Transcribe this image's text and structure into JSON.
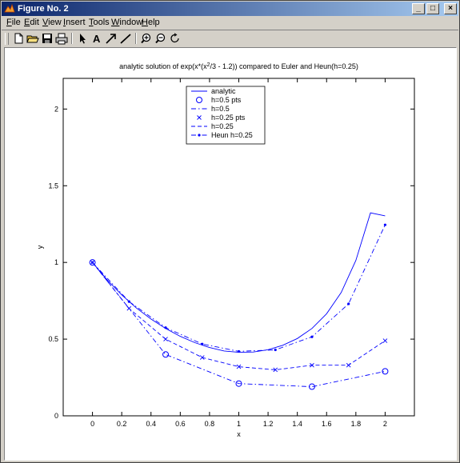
{
  "window": {
    "title": "Figure No. 2",
    "buttons": {
      "minimize": "_",
      "maximize": "□",
      "close": "×"
    }
  },
  "menu": {
    "items": [
      {
        "label": "File",
        "key": "F"
      },
      {
        "label": "Edit",
        "key": "E"
      },
      {
        "label": "View",
        "key": "V"
      },
      {
        "label": "Insert",
        "key": "I"
      },
      {
        "label": "Tools",
        "key": "T"
      },
      {
        "label": "Window",
        "key": "W"
      },
      {
        "label": "Help",
        "key": "H"
      }
    ]
  },
  "toolbar": {
    "icons": [
      "new-file-icon",
      "open-folder-icon",
      "save-icon",
      "print-icon",
      "arrow-select-icon",
      "text-insert-icon",
      "arrow-insert-icon",
      "line-insert-icon",
      "zoom-in-icon",
      "zoom-out-icon",
      "rotate-3d-icon"
    ]
  },
  "chart_data": {
    "type": "line",
    "title": "analytic solution of exp(x*(x²/3 - 1.2)) compared to Euler and Heun(h=0.25)",
    "xlabel": "x",
    "ylabel": "y",
    "xlim": [
      -0.2,
      2.2
    ],
    "ylim": [
      0,
      2.2
    ],
    "xticks": [
      "0",
      "0.2",
      "0.4",
      "0.6",
      "0.8",
      "1",
      "1.2",
      "1.4",
      "1.6",
      "1.8",
      "2"
    ],
    "xtick_values": [
      0,
      0.2,
      0.4,
      0.6,
      0.8,
      1,
      1.2,
      1.4,
      1.6,
      1.8,
      2
    ],
    "yticks": [
      "0",
      "0.5",
      "1",
      "1.5",
      "2"
    ],
    "ytick_values": [
      0,
      0.5,
      1,
      1.5,
      2
    ],
    "grid": false,
    "legend_position": "top-center",
    "color": "#0000ff",
    "series": [
      {
        "name": "analytic",
        "style": "solid",
        "marker": "none",
        "x": [
          0,
          0.1,
          0.2,
          0.3,
          0.4,
          0.5,
          0.6,
          0.7,
          0.8,
          0.9,
          1.0,
          1.1,
          1.2,
          1.3,
          1.4,
          1.5,
          1.6,
          1.7,
          1.8,
          1.9,
          2.0
        ],
        "y": [
          1.0,
          0.887,
          0.788,
          0.703,
          0.631,
          0.57,
          0.518,
          0.477,
          0.445,
          0.423,
          0.414,
          0.416,
          0.431,
          0.46,
          0.504,
          0.57,
          0.665,
          0.804,
          1.013,
          1.323,
          1.304
        ]
      },
      {
        "name": "h=0.5 pts",
        "style": "none",
        "marker": "circle",
        "x": [
          0,
          0.5,
          1.0,
          1.5,
          2.0
        ],
        "y": [
          1.0,
          0.4,
          0.21,
          0.19,
          0.29
        ]
      },
      {
        "name": "h=0.5",
        "style": "dashdot",
        "marker": "none",
        "x": [
          0,
          0.5,
          1.0,
          1.5,
          2.0
        ],
        "y": [
          1.0,
          0.4,
          0.21,
          0.19,
          0.29
        ]
      },
      {
        "name": "h=0.25 pts",
        "style": "none",
        "marker": "x",
        "x": [
          0,
          0.25,
          0.5,
          0.75,
          1.0,
          1.25,
          1.5,
          1.75,
          2.0
        ],
        "y": [
          1.0,
          0.7,
          0.5,
          0.38,
          0.32,
          0.3,
          0.33,
          0.33,
          0.49
        ]
      },
      {
        "name": "h=0.25",
        "style": "dash",
        "marker": "none",
        "x": [
          0,
          0.25,
          0.5,
          0.75,
          1.0,
          1.25,
          1.5,
          1.75,
          2.0
        ],
        "y": [
          1.0,
          0.7,
          0.5,
          0.38,
          0.32,
          0.3,
          0.33,
          0.33,
          0.49
        ]
      },
      {
        "name": "Heun h=0.25",
        "style": "dashdot",
        "marker": "dot",
        "x": [
          0,
          0.25,
          0.5,
          0.75,
          1.0,
          1.25,
          1.5,
          1.75,
          2.0
        ],
        "y": [
          1.0,
          0.745,
          0.575,
          0.468,
          0.42,
          0.43,
          0.515,
          0.73,
          1.245
        ]
      }
    ]
  }
}
